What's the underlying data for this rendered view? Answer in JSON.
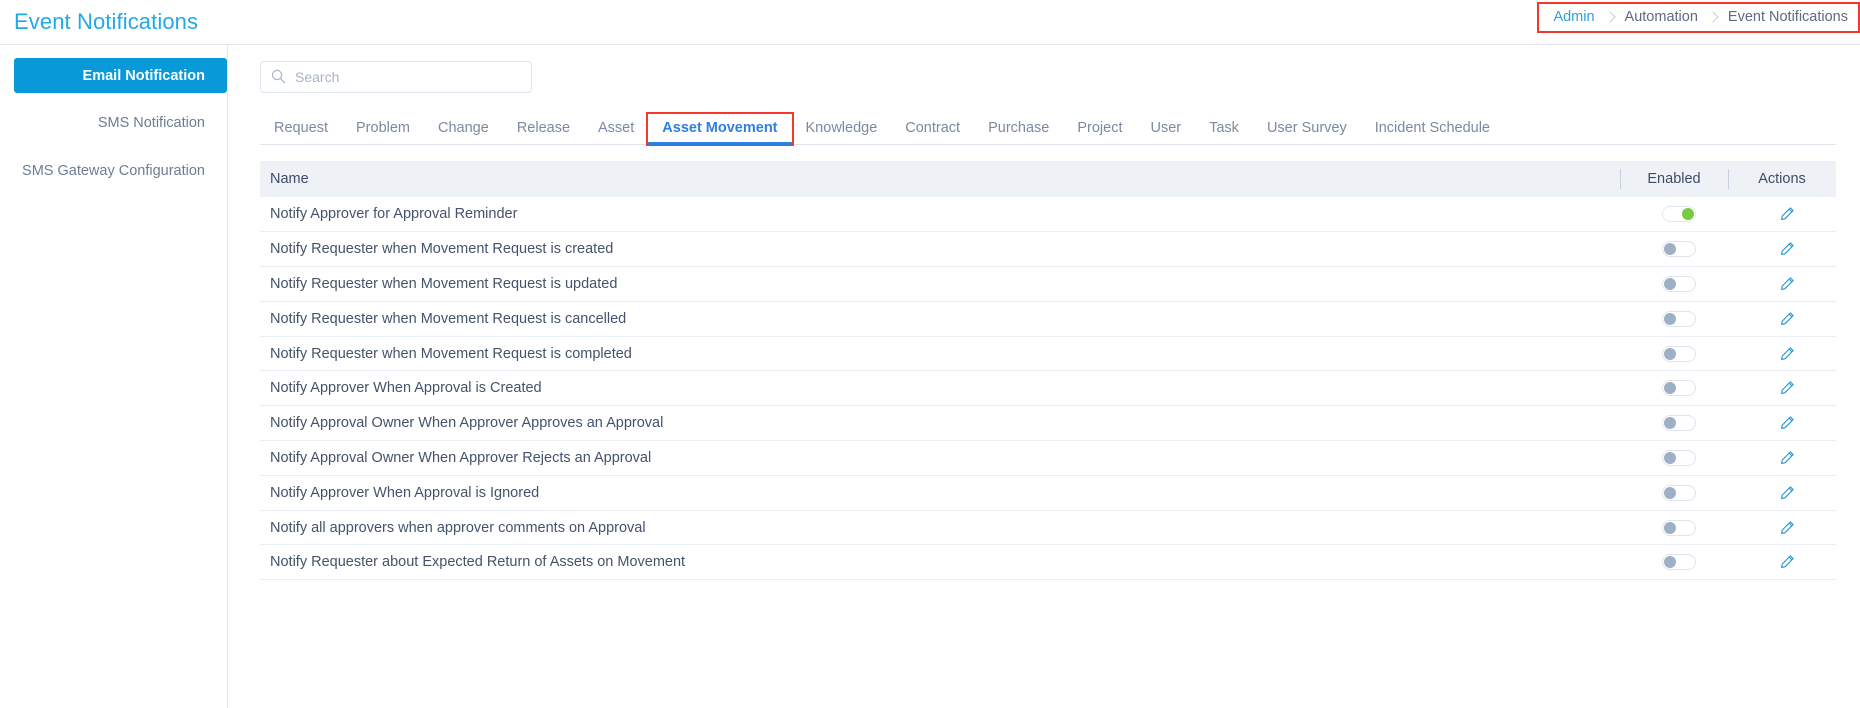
{
  "header": {
    "title": "Event Notifications",
    "breadcrumb": [
      {
        "label": "Admin",
        "link": true
      },
      {
        "label": "Automation",
        "link": false
      },
      {
        "label": "Event Notifications",
        "link": false
      }
    ]
  },
  "sidebar": {
    "items": [
      {
        "label": "Email Notification",
        "active": true
      },
      {
        "label": "SMS Notification",
        "active": false
      },
      {
        "label": "SMS Gateway Configuration",
        "active": false
      }
    ]
  },
  "search": {
    "value": "",
    "placeholder": "Search",
    "icon": "search-icon"
  },
  "tabs": {
    "items": [
      {
        "label": "Request",
        "active": false
      },
      {
        "label": "Problem",
        "active": false
      },
      {
        "label": "Change",
        "active": false
      },
      {
        "label": "Release",
        "active": false
      },
      {
        "label": "Asset",
        "active": false
      },
      {
        "label": "Asset Movement",
        "active": true,
        "highlighted": true
      },
      {
        "label": "Knowledge",
        "active": false
      },
      {
        "label": "Contract",
        "active": false
      },
      {
        "label": "Purchase",
        "active": false
      },
      {
        "label": "Project",
        "active": false
      },
      {
        "label": "User",
        "active": false
      },
      {
        "label": "Task",
        "active": false
      },
      {
        "label": "User Survey",
        "active": false
      },
      {
        "label": "Incident Schedule",
        "active": false
      }
    ]
  },
  "table": {
    "columns": [
      "Name",
      "Enabled",
      "Actions"
    ],
    "rows": [
      {
        "name": "Notify Approver for Approval Reminder",
        "enabled": true,
        "action_icon": "edit-pencil-icon"
      },
      {
        "name": "Notify Requester when Movement Request is created",
        "enabled": false,
        "action_icon": "edit-pencil-icon"
      },
      {
        "name": "Notify Requester when Movement Request is updated",
        "enabled": false,
        "action_icon": "edit-pencil-icon"
      },
      {
        "name": "Notify Requester when Movement Request is cancelled",
        "enabled": false,
        "action_icon": "edit-pencil-icon"
      },
      {
        "name": "Notify Requester when Movement Request is completed",
        "enabled": false,
        "action_icon": "edit-pencil-icon"
      },
      {
        "name": "Notify Approver When Approval is Created",
        "enabled": false,
        "action_icon": "edit-pencil-icon"
      },
      {
        "name": "Notify Approval Owner When Approver Approves an Approval",
        "enabled": false,
        "action_icon": "edit-pencil-icon"
      },
      {
        "name": "Notify Approval Owner When Approver Rejects an Approval",
        "enabled": false,
        "action_icon": "edit-pencil-icon"
      },
      {
        "name": "Notify Approver When Approval is Ignored",
        "enabled": false,
        "action_icon": "edit-pencil-icon"
      },
      {
        "name": "Notify all approvers when approver comments on Approval",
        "enabled": false,
        "action_icon": "edit-pencil-icon"
      },
      {
        "name": "Notify Requester about Expected Return of Assets on Movement",
        "enabled": false,
        "action_icon": "edit-pencil-icon"
      }
    ]
  },
  "colors": {
    "accent_blue": "#21a8e8",
    "active_tab_blue": "#2f7fe0",
    "sidebar_active_bg": "#089ad8",
    "highlight_red": "#f4372c",
    "toggle_on_green": "#7ac943",
    "toggle_off_gray": "#9fb0c6",
    "header_bg": "#eef2f7"
  }
}
